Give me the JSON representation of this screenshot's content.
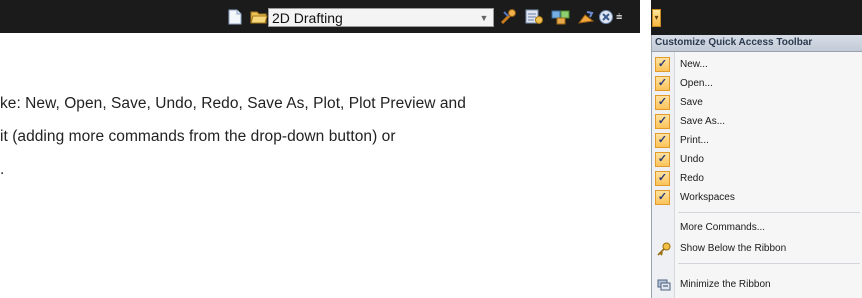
{
  "toolbar": {
    "workspace_value": "2D Drafting",
    "icons": [
      "new-icon",
      "open-icon",
      "save-icon",
      "save-as-icon",
      "plot-icon",
      "undo-icon",
      "redo-icon",
      "wrench-icon",
      "properties-icon",
      "workspace-tool-icon",
      "lock-icon",
      "hardware-icon"
    ],
    "overflow_glyph": "⩧"
  },
  "body_text": {
    "line1": "ke: New, Open, Save, Undo, Redo, Save As, Plot, Plot Preview and",
    "line2": "it (adding more commands from the drop-down button) or",
    "line3": "."
  },
  "menu": {
    "drop_glyph": "▾",
    "header": "Customize Quick Access Toolbar",
    "check_glyph": "✓",
    "checked_items": [
      {
        "label": "New..."
      },
      {
        "label": "Open..."
      },
      {
        "label": "Save"
      },
      {
        "label": "Save As..."
      },
      {
        "label": "Print..."
      },
      {
        "label": "Undo"
      },
      {
        "label": "Redo"
      },
      {
        "label": "Workspaces"
      }
    ],
    "more_commands": "More Commands...",
    "show_below": "Show Below the Ribbon",
    "minimize": "Minimize the Ribbon"
  },
  "colors": {
    "toolbar_bg": "#1b1b1b",
    "check_fill": "#fcc35a",
    "header_bg": "#c2cad6"
  }
}
